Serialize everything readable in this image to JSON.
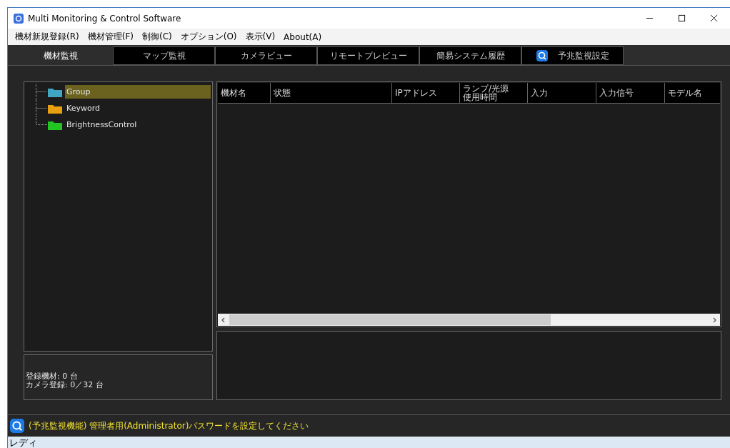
{
  "window": {
    "title": "Multi Monitoring & Control Software"
  },
  "menu": [
    "機材新規登録(R)",
    "機材管理(F)",
    "制御(C)",
    "オプション(O)",
    "表示(V)",
    "About(A)"
  ],
  "tabs": [
    {
      "label": "機材監視",
      "selected": true,
      "kind": "plain"
    },
    {
      "label": "マップ監視",
      "selected": false,
      "kind": "plain"
    },
    {
      "label": "カメラビュー",
      "selected": false,
      "kind": "plain"
    },
    {
      "label": "リモートプレビュー",
      "selected": false,
      "kind": "plain"
    },
    {
      "label": "簡易システム履歴",
      "selected": false,
      "kind": "plain"
    },
    {
      "label": "予兆監視設定",
      "selected": false,
      "kind": "icon"
    }
  ],
  "tree": [
    {
      "label": "Group",
      "selected": true,
      "color": "#3fa7c4"
    },
    {
      "label": "Keyword",
      "selected": false,
      "color": "#e8a010"
    },
    {
      "label": "BrightnessControl",
      "selected": false,
      "color": "#22c322"
    }
  ],
  "summary": [
    "登録機材: 0 台",
    "カメラ登録: 0／32 台"
  ],
  "table": {
    "columns": [
      [
        "機材名"
      ],
      [
        "状態"
      ],
      [
        "IPアドレス"
      ],
      [
        "ランプ/光源",
        "使用時間"
      ],
      [
        "入力"
      ],
      [
        "入力信号"
      ],
      [
        "モデル名"
      ]
    ]
  },
  "notice": "(予兆監視機能) 管理者用(Administrator)パスワードを設定してください",
  "status_bar": "レディ"
}
